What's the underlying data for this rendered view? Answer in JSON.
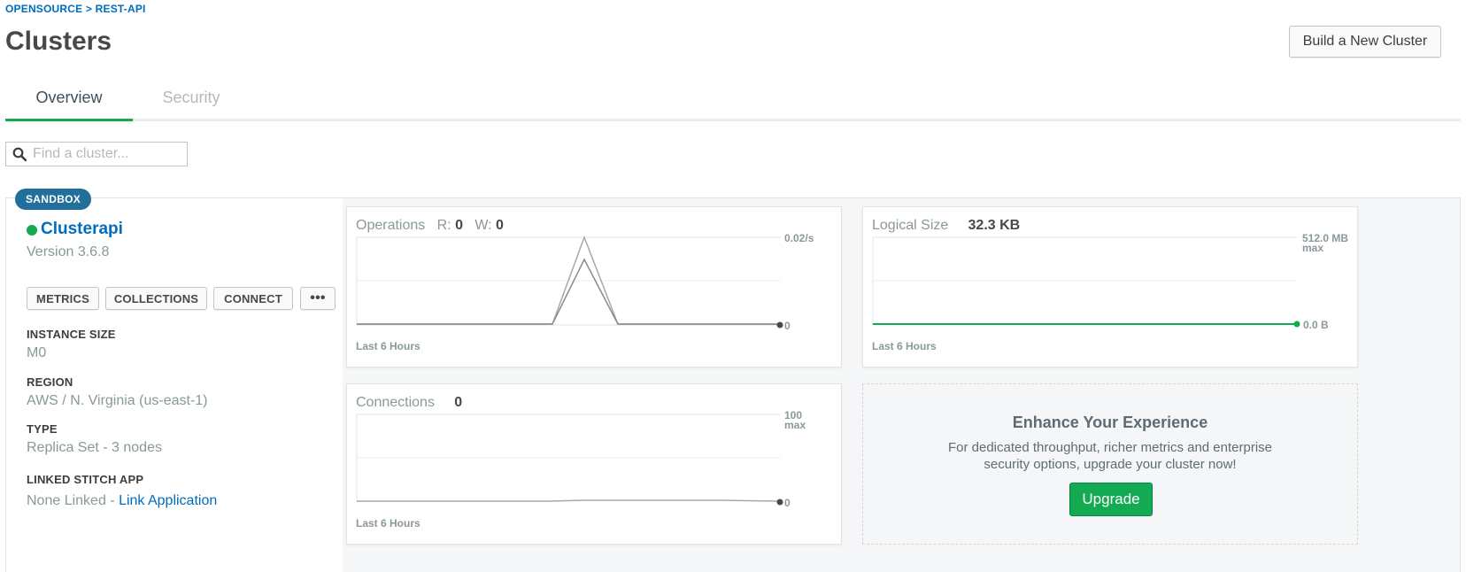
{
  "breadcrumb": "OPENSOURCE > REST-API",
  "page_title": "Clusters",
  "build_button_label": "Build a New Cluster",
  "tabs": [
    {
      "label": "Overview",
      "active": true
    },
    {
      "label": "Security",
      "active": false
    }
  ],
  "search": {
    "placeholder": "Find a cluster...",
    "value": ""
  },
  "cluster": {
    "badge": "SANDBOX",
    "name": "Clusterapi",
    "status_color": "#13aa52",
    "version": "Version 3.6.8",
    "actions": [
      "METRICS",
      "COLLECTIONS",
      "CONNECT",
      "•••"
    ],
    "info": [
      {
        "label": "INSTANCE SIZE",
        "value": "M0"
      },
      {
        "label": "REGION",
        "value": "AWS / N. Virginia (us-east-1)"
      },
      {
        "label": "TYPE",
        "value": "Replica Set - 3 nodes"
      },
      {
        "label": "LINKED STITCH APP",
        "value": "None Linked - ",
        "link": "Link Application"
      }
    ]
  },
  "charts": {
    "operations": {
      "title": "Operations",
      "r_label": "R:",
      "r_value": "0",
      "w_label": "W:",
      "w_value": "0",
      "y_max_label": "0.02/s",
      "y_min_label": "0",
      "footer": "Last 6 Hours"
    },
    "logical_size": {
      "title": "Logical Size",
      "value": "32.3 KB",
      "y_max_label": "512.0 MB",
      "y_max_sub": "max",
      "y_min_label": "0.0 B",
      "footer": "Last 6 Hours",
      "line_color": "#13aa52"
    },
    "connections": {
      "title": "Connections",
      "value": "0",
      "y_max_label": "100",
      "y_max_sub": "max",
      "y_min_label": "0",
      "footer": "Last 6 Hours"
    }
  },
  "upgrade": {
    "title": "Enhance Your Experience",
    "text": "For dedicated throughput, richer metrics and enterprise security options, upgrade your cluster now!",
    "button": "Upgrade"
  },
  "colors": {
    "accent": "#13aa52",
    "link": "#006cbc",
    "badge": "#21709b"
  }
}
